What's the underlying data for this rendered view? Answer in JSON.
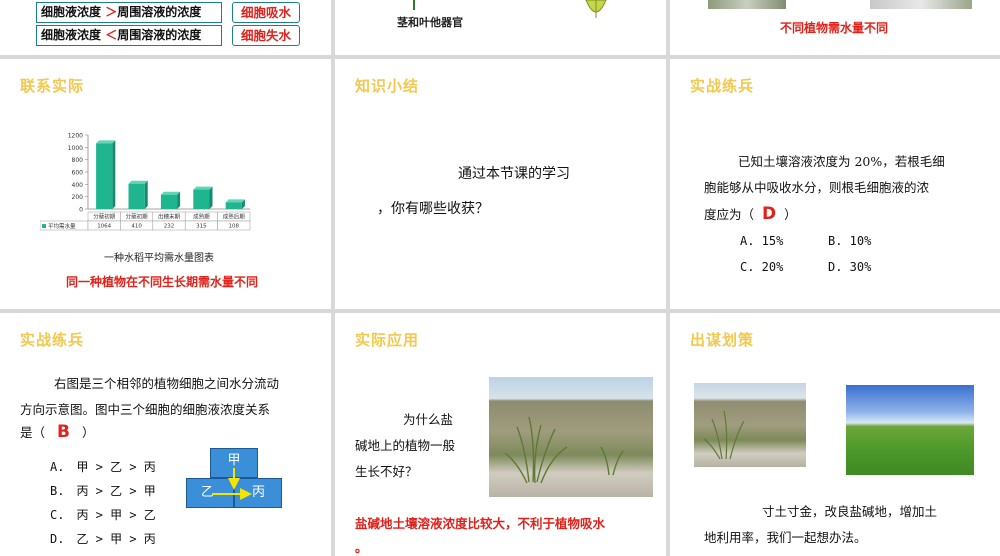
{
  "top_row": {
    "left": {
      "row1": {
        "label": "细胞液浓度",
        "symbol": "＞",
        "right_label": "周围溶液的浓度",
        "result": "细胞吸水"
      },
      "row2": {
        "label": "细胞液浓度",
        "symbol": "＜",
        "right_label": "周围溶液的浓度",
        "result": "细胞失水"
      }
    },
    "middle": {
      "caption": "茎和叶他器官"
    },
    "right": {
      "caption": "不同植物需水量不同"
    }
  },
  "slide_contact": {
    "title": "联系实际",
    "chart_caption": "一种水稻平均需水量图表",
    "conclusion": "同一种植物在不同生长期需水量不同"
  },
  "slide_summary": {
    "title": "知识小结",
    "line1": "通过本节课的学习",
    "line2": "，你有哪些收获？"
  },
  "slide_practice1": {
    "title": "实战练兵",
    "question_line1": "已知土壤溶液浓度为 20%，若根毛细",
    "question_line2": "胞能够从中吸收水分，则根毛细胞液的浓",
    "question_line3_prefix": "度应为（",
    "answer": "D",
    "question_line3_suffix": "）",
    "options": [
      "A. 15%",
      "B. 10%",
      "C. 20%",
      "D. 30%"
    ]
  },
  "slide_practice2": {
    "title": "实战练兵",
    "question_line1": "右图是三个相邻的植物细胞之间水分流动",
    "question_line2": "方向示意图。图中三个细胞的细胞液浓度关系",
    "question_line3_prefix": "是（",
    "answer": "B",
    "question_line3_suffix": "）",
    "options": [
      "A.　甲 > 乙 > 丙",
      "B.　丙 > 乙 > 甲",
      "C.　丙 > 甲 > 乙",
      "D.　乙 > 甲 > 丙"
    ],
    "diagram": {
      "top": "甲",
      "left": "乙",
      "right": "丙"
    }
  },
  "slide_apply": {
    "title": "实际应用",
    "question": [
      "为什么盐",
      "碱地上的植物一般",
      "生长不好？"
    ],
    "answer_line1": "盐碱地土壤溶液浓度比较大，不利于植物吸水",
    "answer_line2": "。"
  },
  "slide_plan": {
    "title": "出谋划策",
    "line1": "寸土寸金，改良盐碱地，增加土",
    "line2": "地利用率，我们一起想办法。"
  },
  "chart_data": {
    "type": "bar",
    "categories": [
      "分蘖初期",
      "分蘖初期",
      "出穗末期",
      "成熟期",
      "成熟后期"
    ],
    "values": [
      1064,
      410,
      232,
      315,
      108
    ],
    "series": [
      {
        "name": "平均需水量",
        "values": [
          1064,
          410,
          232,
          315,
          108
        ]
      }
    ],
    "y_ticks": [
      0,
      200,
      400,
      600,
      800,
      1000,
      1200
    ],
    "ylim": [
      0,
      1200
    ],
    "bar_color": "#1fb58f",
    "legend_placement": "bottom-table"
  }
}
